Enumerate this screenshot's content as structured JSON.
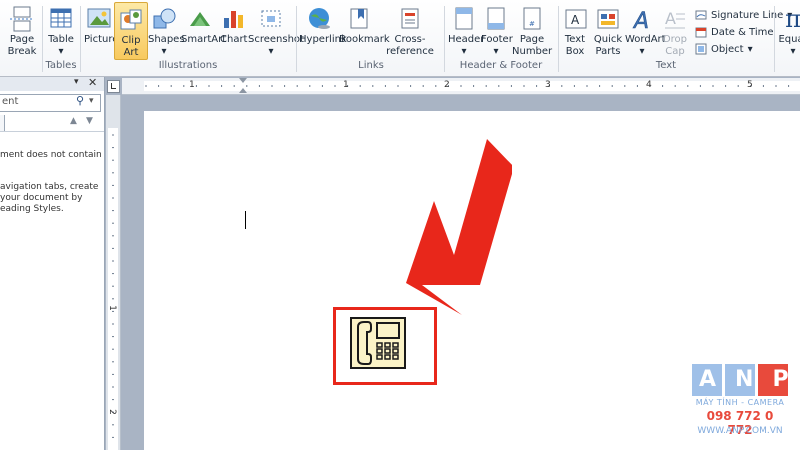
{
  "ribbon": {
    "buttons": {
      "page_break": [
        "Page",
        "Break"
      ],
      "table": "Table",
      "picture": "Picture",
      "clip_art": [
        "Clip",
        "Art"
      ],
      "shapes": "Shapes",
      "smartart": "SmartArt",
      "chart": "Chart",
      "screenshot": "Screenshot",
      "hyperlink": "Hyperlink",
      "bookmark": "Bookmark",
      "cross_reference": "Cross-reference",
      "header": "Header",
      "footer": "Footer",
      "page_number": [
        "Page",
        "Number"
      ],
      "text_box": [
        "Text",
        "Box"
      ],
      "quick_parts": [
        "Quick",
        "Parts"
      ],
      "wordart": "WordArt",
      "drop_cap": [
        "Drop",
        "Cap"
      ],
      "equation": "Equat"
    },
    "text_small": {
      "signature_line": "Signature Line",
      "date_time": "Date & Time",
      "object": "Object"
    },
    "groups": {
      "tables": "Tables",
      "illustrations": "Illustrations",
      "links": "Links",
      "header_footer": "Header & Footer",
      "text": "Text"
    }
  },
  "nav_pane": {
    "search_placeholder": "ent",
    "message1": "ment does not contain",
    "message2": [
      "avigation tabs, create",
      "your document by",
      "eading Styles."
    ]
  },
  "ruler": {
    "h_numbers": [
      "1",
      "1",
      "2",
      "3",
      "4",
      "5"
    ],
    "v_numbers": [
      "1",
      "2"
    ]
  },
  "watermark": {
    "brand": "ANP",
    "subtitle": "MÁY TÍNH - CAMERA",
    "phone": "098 772 0 772",
    "website": "WWW.ANP.COM.VN"
  },
  "colors": {
    "accent_red": "#e8271b",
    "anp_blue": "#9fc0e8",
    "anp_red": "#e84a3c",
    "ribbon_active": "#f8c95e"
  }
}
